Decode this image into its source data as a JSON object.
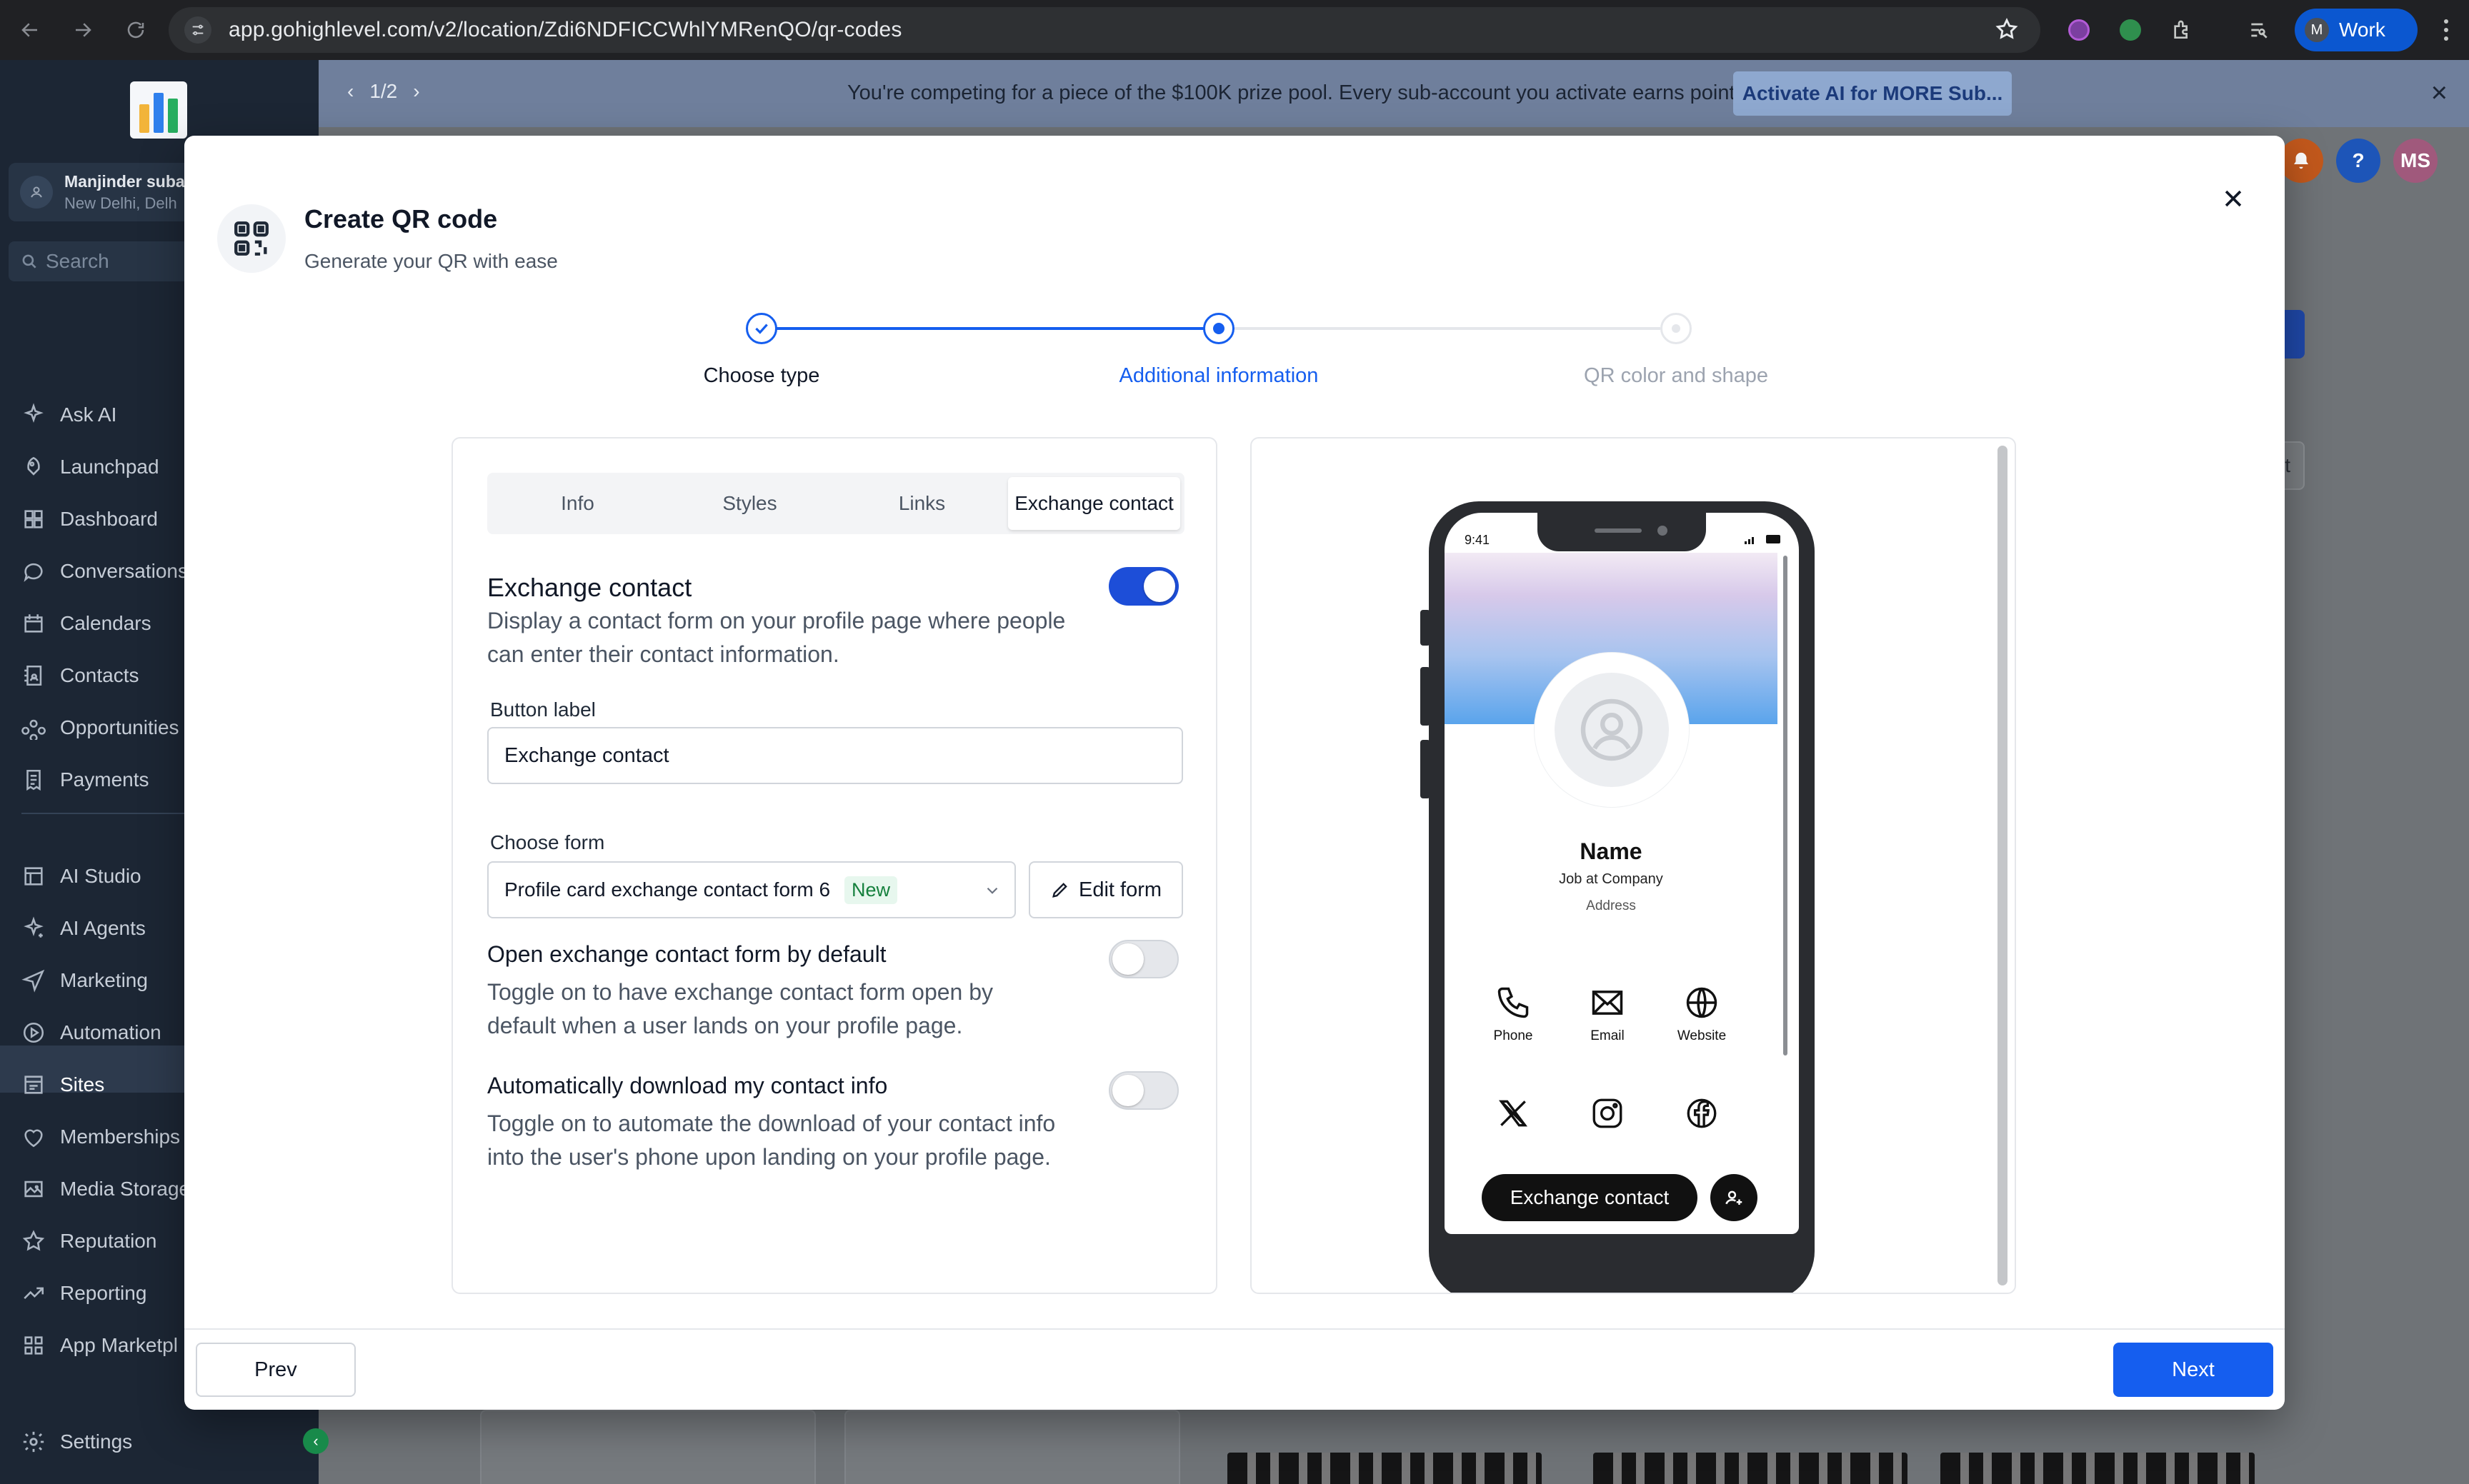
{
  "browser": {
    "url": "app.gohighlevel.com/v2/location/Zdi6NDFICCWhlYMRenQO/qr-codes",
    "profile_initial": "M",
    "profile_label": "Work"
  },
  "sidebar": {
    "account_name": "Manjinder suba",
    "account_location": "New Delhi, Delh",
    "search_placeholder": "Search",
    "items": [
      {
        "label": "Ask AI",
        "icon": "sparkle-icon"
      },
      {
        "label": "Launchpad",
        "icon": "rocket-icon"
      },
      {
        "label": "Dashboard",
        "icon": "grid-icon"
      },
      {
        "label": "Conversations",
        "icon": "chat-icon"
      },
      {
        "label": "Calendars",
        "icon": "calendar-icon"
      },
      {
        "label": "Contacts",
        "icon": "contacts-icon"
      },
      {
        "label": "Opportunities",
        "icon": "funnel-icon"
      },
      {
        "label": "Payments",
        "icon": "receipt-icon"
      },
      {
        "label": "AI Studio",
        "icon": "studio-icon"
      },
      {
        "label": "AI Agents",
        "icon": "agent-icon"
      },
      {
        "label": "Marketing",
        "icon": "send-icon"
      },
      {
        "label": "Automation",
        "icon": "automation-icon"
      },
      {
        "label": "Sites",
        "icon": "sites-icon"
      },
      {
        "label": "Memberships",
        "icon": "membership-icon"
      },
      {
        "label": "Media Storage",
        "icon": "image-icon"
      },
      {
        "label": "Reputation",
        "icon": "star-icon"
      },
      {
        "label": "Reporting",
        "icon": "trend-icon"
      },
      {
        "label": "App Marketpl",
        "icon": "apps-icon"
      }
    ],
    "settings_label": "Settings"
  },
  "banner": {
    "pager": "1/2",
    "message": "You're competing for a piece of the $100K prize pool. Every sub-account you activate earns points.",
    "cta": "Activate AI for MORE Sub..."
  },
  "header": {
    "help": "?",
    "user_initials": "MS"
  },
  "background": {
    "partial_button_text": "ct"
  },
  "modal": {
    "title": "Create QR code",
    "subtitle": "Generate your QR with ease",
    "steps": [
      {
        "label": "Choose type",
        "state": "done"
      },
      {
        "label": "Additional information",
        "state": "current"
      },
      {
        "label": "QR color and shape",
        "state": "upcoming"
      }
    ],
    "tabs": [
      "Info",
      "Styles",
      "Links",
      "Exchange contact"
    ],
    "active_tab": "Exchange contact",
    "exchange": {
      "title": "Exchange contact",
      "description": "Display a contact form on your profile page where people can enter their contact information.",
      "enabled": true,
      "button_label_title": "Button label",
      "button_label_value": "Exchange contact",
      "choose_form_title": "Choose form",
      "form_value": "Profile card exchange contact form 6",
      "form_badge": "New",
      "edit_form": "Edit form",
      "open_default_title": "Open exchange contact form by default",
      "open_default_desc": "Toggle on to have exchange contact form open by default when a user lands on your profile page.",
      "open_default_on": false,
      "auto_download_title": "Automatically download my contact info",
      "auto_download_desc": "Toggle on to automate the download of your contact info into the user's phone upon landing on your profile page.",
      "auto_download_on": false
    },
    "preview": {
      "time": "9:41",
      "name": "Name",
      "job": "Job at Company",
      "address": "Address",
      "contacts": [
        "Phone",
        "Email",
        "Website"
      ],
      "exchange_button": "Exchange contact"
    },
    "prev": "Prev",
    "next": "Next"
  },
  "colors": {
    "primary": "#155eef",
    "toggle_on": "#1d4ed8",
    "badge_green": "#15803d",
    "sidebar_bg": "#1c2634"
  }
}
